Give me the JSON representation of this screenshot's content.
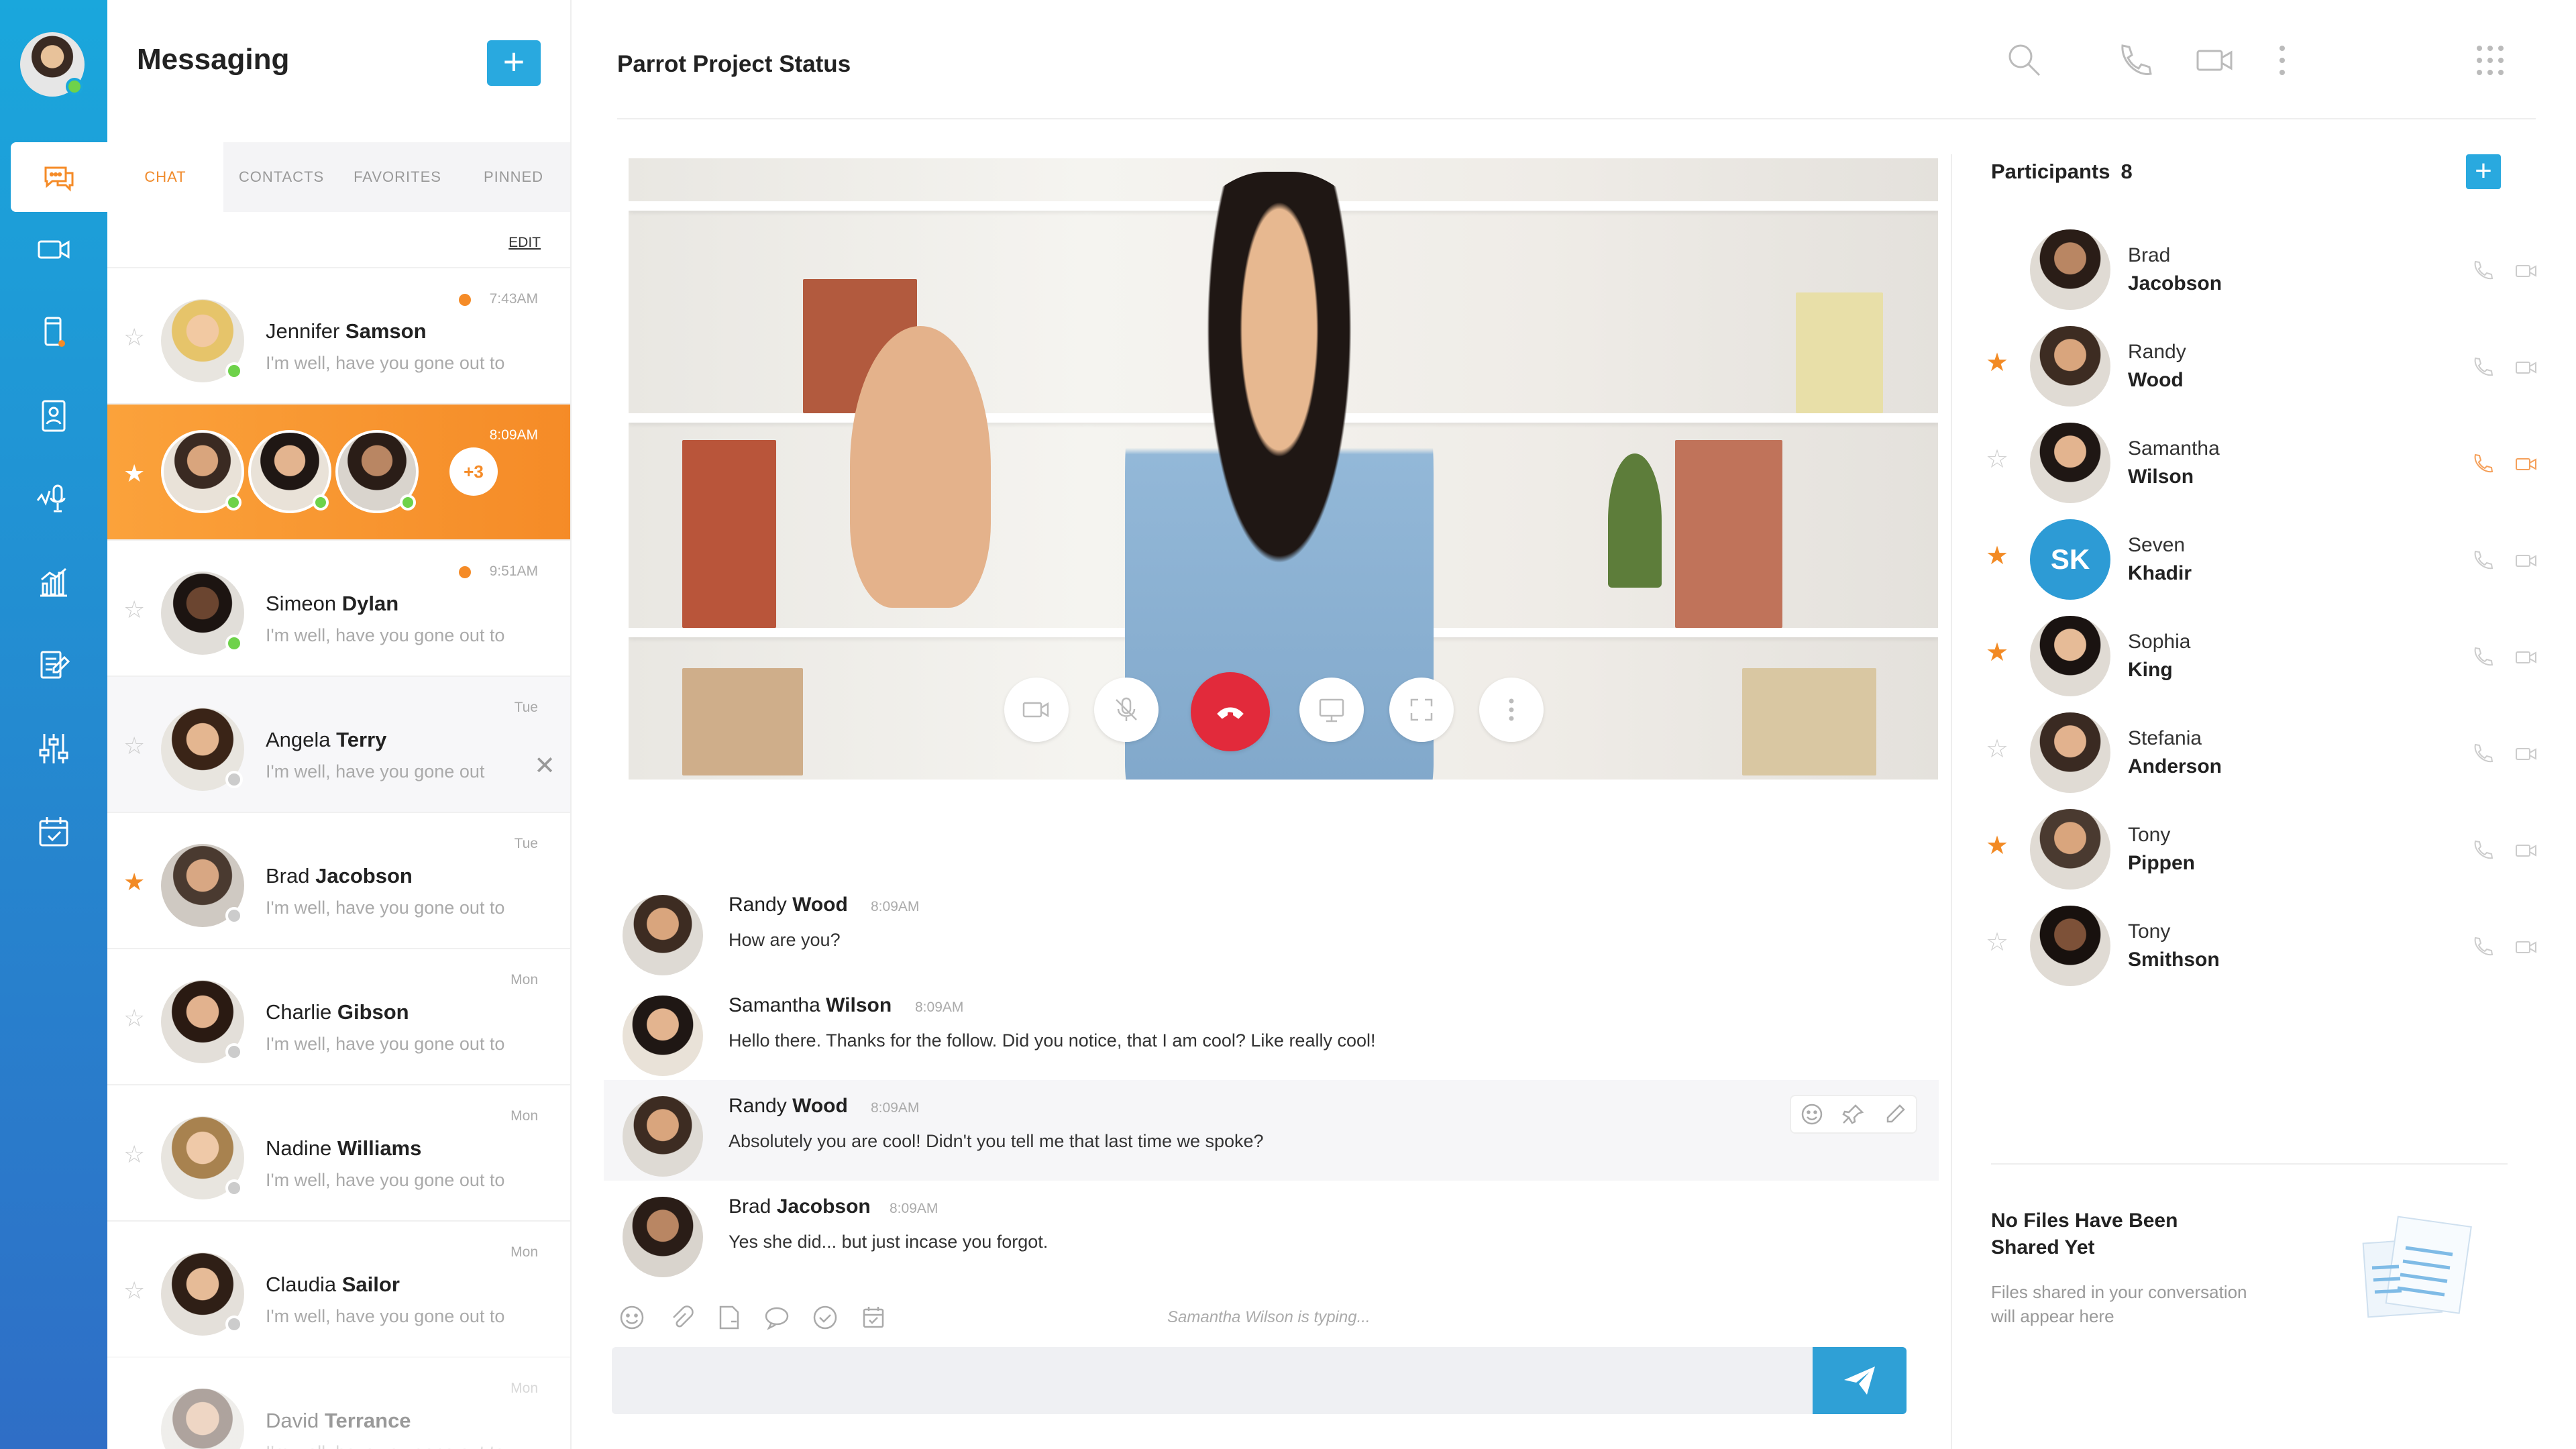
{
  "app": {
    "title": "Messaging"
  },
  "tabs": [
    "CHAT",
    "CONTACTS",
    "FAVORITES",
    "PINNED"
  ],
  "edit_label": "EDIT",
  "conversations": [
    {
      "first": "Jennifer",
      "last": "Samson",
      "preview": "I'm well, have you gone out to",
      "time": "7:43AM",
      "starred": false,
      "unread": true
    },
    {
      "group": true,
      "more": "+3",
      "time": "8:09AM",
      "starred": true
    },
    {
      "first": "Simeon",
      "last": "Dylan",
      "preview": "I'm well, have you gone out to",
      "time": "9:51AM",
      "starred": false,
      "unread": true
    },
    {
      "first": "Angela",
      "last": "Terry",
      "preview": "I'm well, have you gone out",
      "time": "Tue",
      "starred": false
    },
    {
      "first": "Brad",
      "last": "Jacobson",
      "preview": "I'm well, have you gone out to",
      "time": "Tue",
      "starred": true
    },
    {
      "first": "Charlie",
      "last": "Gibson",
      "preview": "I'm well, have you gone out to",
      "time": "Mon",
      "starred": false
    },
    {
      "first": "Nadine",
      "last": "Williams",
      "preview": "I'm well, have you gone out to",
      "time": "Mon",
      "starred": false
    },
    {
      "first": "Claudia",
      "last": "Sailor",
      "preview": "I'm well, have you gone out to",
      "time": "Mon",
      "starred": false
    },
    {
      "first": "David",
      "last": "Terrance",
      "preview": "I'm well, have you gone out to",
      "time": "Mon",
      "starred": false
    }
  ],
  "chat": {
    "title": "Parrot Project Status"
  },
  "messages": [
    {
      "first": "Randy",
      "last": "Wood",
      "time": "8:09AM",
      "text": "How are you?"
    },
    {
      "first": "Samantha",
      "last": "Wilson",
      "time": "8:09AM",
      "text": "Hello there. Thanks for the follow. Did you notice, that I am cool? Like really cool!"
    },
    {
      "first": "Randy",
      "last": "Wood",
      "time": "8:09AM",
      "text": "Absolutely you are cool! Didn't you tell me that last time we spoke?"
    },
    {
      "first": "Brad",
      "last": "Jacobson",
      "time": "8:09AM",
      "text": "Yes she did... but just incase you forgot."
    }
  ],
  "typing": "Samantha Wilson is typing...",
  "participants": {
    "label": "Participants",
    "count": "8",
    "list": [
      {
        "first": "Brad",
        "last": "Jacobson",
        "star": null
      },
      {
        "first": "Randy",
        "last": "Wood",
        "star": true
      },
      {
        "first": "Samantha",
        "last": "Wilson",
        "star": false
      },
      {
        "first": "Seven",
        "last": "Khadir",
        "star": true,
        "initials": "SK"
      },
      {
        "first": "Sophia",
        "last": "King",
        "star": true
      },
      {
        "first": "Stefania",
        "last": "Anderson",
        "star": false
      },
      {
        "first": "Tony",
        "last": "Pippen",
        "star": true
      },
      {
        "first": "Tony",
        "last": "Smithson",
        "star": false
      }
    ]
  },
  "files": {
    "title": "No Files Have Been Shared Yet",
    "subtitle": "Files shared in your conversation will appear here"
  },
  "colors": {
    "accent": "#29a9df",
    "orange": "#f58b27",
    "end_call": "#e22a3b"
  }
}
